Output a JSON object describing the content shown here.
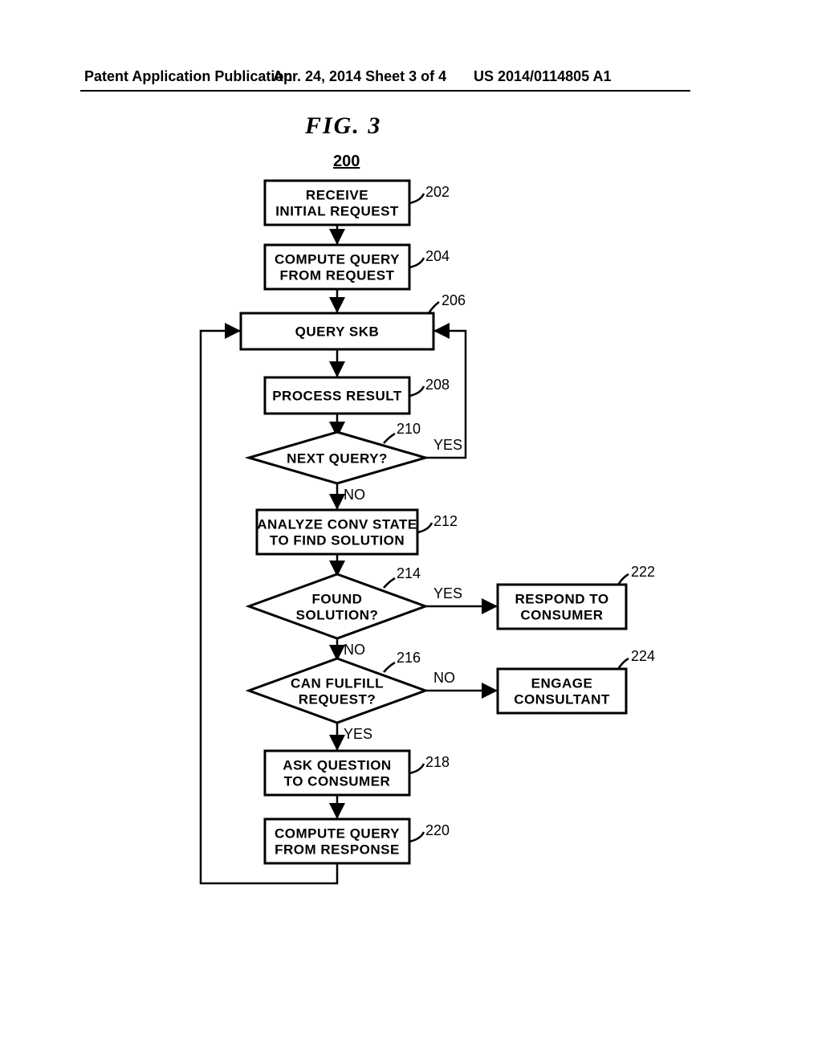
{
  "header": {
    "left": "Patent Application Publication",
    "mid": "Apr. 24, 2014  Sheet 3 of 4",
    "right": "US 2014/0114805 A1"
  },
  "figure": {
    "title": "FIG.   3",
    "number": "200"
  },
  "nodes": {
    "b202": {
      "l1": "RECEIVE",
      "l2": "INITIAL REQUEST",
      "ref": "202"
    },
    "b204": {
      "l1": "COMPUTE QUERY",
      "l2": "FROM REQUEST",
      "ref": "204"
    },
    "b206": {
      "l1": "QUERY SKB",
      "ref": "206"
    },
    "b208": {
      "l1": "PROCESS RESULT",
      "ref": "208"
    },
    "d210": {
      "l1": "NEXT QUERY?",
      "ref": "210",
      "yes": "YES",
      "no": "NO"
    },
    "b212": {
      "l1": "ANALYZE CONV STATE",
      "l2": "TO FIND SOLUTION",
      "ref": "212"
    },
    "d214": {
      "l1": "FOUND",
      "l2": "SOLUTION?",
      "ref": "214",
      "yes": "YES",
      "no": "NO"
    },
    "d216": {
      "l1": "CAN FULFILL",
      "l2": "REQUEST?",
      "ref": "216",
      "yes": "YES",
      "no": "NO"
    },
    "b218": {
      "l1": "ASK QUESTION",
      "l2": "TO CONSUMER",
      "ref": "218"
    },
    "b220": {
      "l1": "COMPUTE QUERY",
      "l2": "FROM RESPONSE",
      "ref": "220"
    },
    "b222": {
      "l1": "RESPOND TO",
      "l2": "CONSUMER",
      "ref": "222"
    },
    "b224": {
      "l1": "ENGAGE",
      "l2": "CONSULTANT",
      "ref": "224"
    }
  }
}
